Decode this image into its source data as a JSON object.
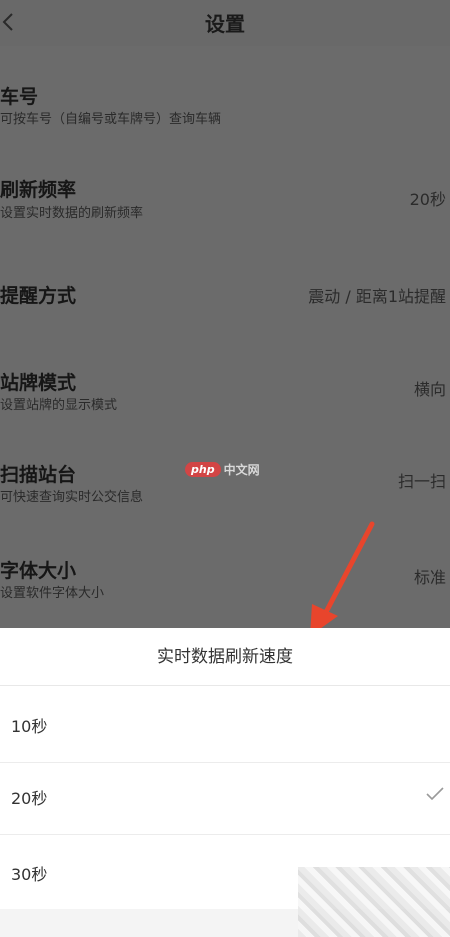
{
  "header": {
    "title": "设置"
  },
  "settings": [
    {
      "label": "车号",
      "sub": "可按车号（自编号或车牌号）查询车辆",
      "value": ""
    },
    {
      "label": "刷新频率",
      "sub": "设置实时数据的刷新频率",
      "value": "20秒"
    },
    {
      "label": "提醒方式",
      "sub": "",
      "value": "震动 / 距离1站提醒"
    },
    {
      "label": "站牌模式",
      "sub": "设置站牌的显示模式",
      "value": "横向"
    },
    {
      "label": "扫描站台",
      "sub": "可快速查询实时公交信息",
      "value": "扫一扫"
    },
    {
      "label": "字体大小",
      "sub": "设置软件字体大小",
      "value": "标准"
    }
  ],
  "watermark": {
    "badge": "php",
    "text": "中文网"
  },
  "sheet": {
    "title": "实时数据刷新速度",
    "options": [
      {
        "label": "10秒",
        "selected": false
      },
      {
        "label": "20秒",
        "selected": true
      },
      {
        "label": "30秒",
        "selected": false
      }
    ]
  },
  "colors": {
    "overlay": "#6b6b6b",
    "arrow": "#e8452c",
    "sheet": "#ffffff"
  },
  "icons": {
    "back": "chevron-left-icon",
    "check": "checkmark-icon"
  }
}
